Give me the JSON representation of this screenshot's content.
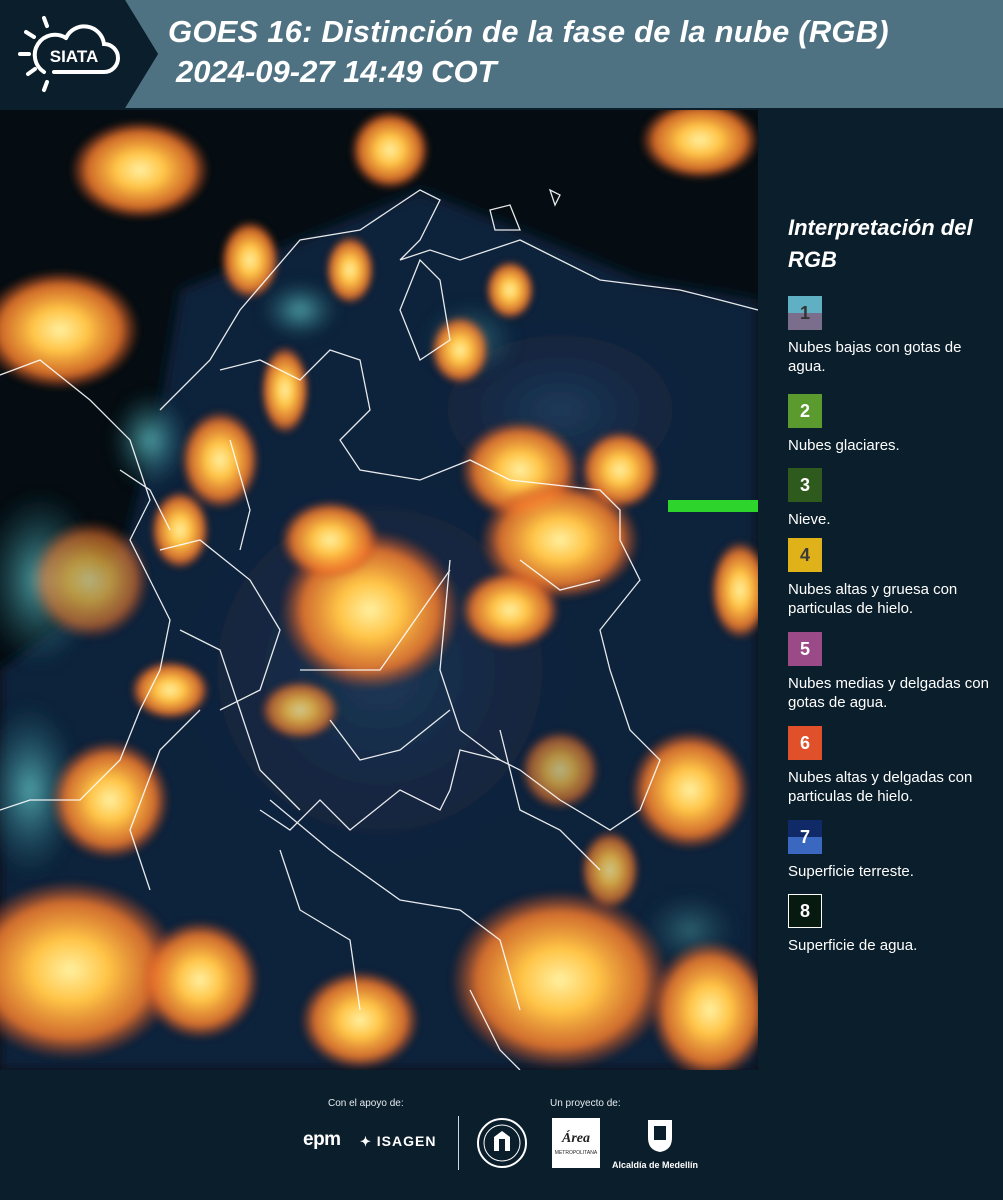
{
  "header": {
    "logo_text": "SIATA",
    "title_line1": "GOES 16: Distinción de la fase de la nube (RGB)",
    "title_line2": "2024-09-27 14:49 COT"
  },
  "map": {
    "description_icon": "satellite-rgb-image"
  },
  "legend": {
    "title": "Interpretación del RGB",
    "items": [
      {
        "number": "1",
        "label": "Nubes bajas con gotas de agua.",
        "color_top": "#5fb0c2",
        "color_bottom": "#7a6e8c"
      },
      {
        "number": "2",
        "label": "Nubes glaciares.",
        "color_top": "#5a9a2e",
        "color_bottom": "#5a9a2e"
      },
      {
        "number": "3",
        "label": "Nieve.",
        "color_top": "#2f5a1e",
        "color_bottom": "#2f5a1e"
      },
      {
        "number": "4",
        "label": "Nubes altas y gruesa con particulas de hielo.",
        "color_top": "#e0b21a",
        "color_bottom": "#e0b21a"
      },
      {
        "number": "5",
        "label": "Nubes medias y delgadas con gotas de agua.",
        "color_top": "#9a4a86",
        "color_bottom": "#9a4a86"
      },
      {
        "number": "6",
        "label": "Nubes altas y delgadas con particulas de hielo.",
        "color_top": "#e0502a",
        "color_bottom": "#e0502a"
      },
      {
        "number": "7",
        "label": "Superficie terreste.",
        "color_top": "#0f2a66",
        "color_bottom": "#3a68c0"
      },
      {
        "number": "8",
        "label": "Superficie de agua.",
        "color_top": "#061a10",
        "color_bottom": "#061a10"
      }
    ]
  },
  "footer": {
    "support_label": "Con el apoyo de:",
    "project_label": "Un proyecto de:",
    "epm_text": "epm",
    "isagen_text": "ISAGEN",
    "area_text": "Área",
    "area_subtext": "METROPOLITANA",
    "alcaldia_text": "Alcaldía de Medellín"
  }
}
